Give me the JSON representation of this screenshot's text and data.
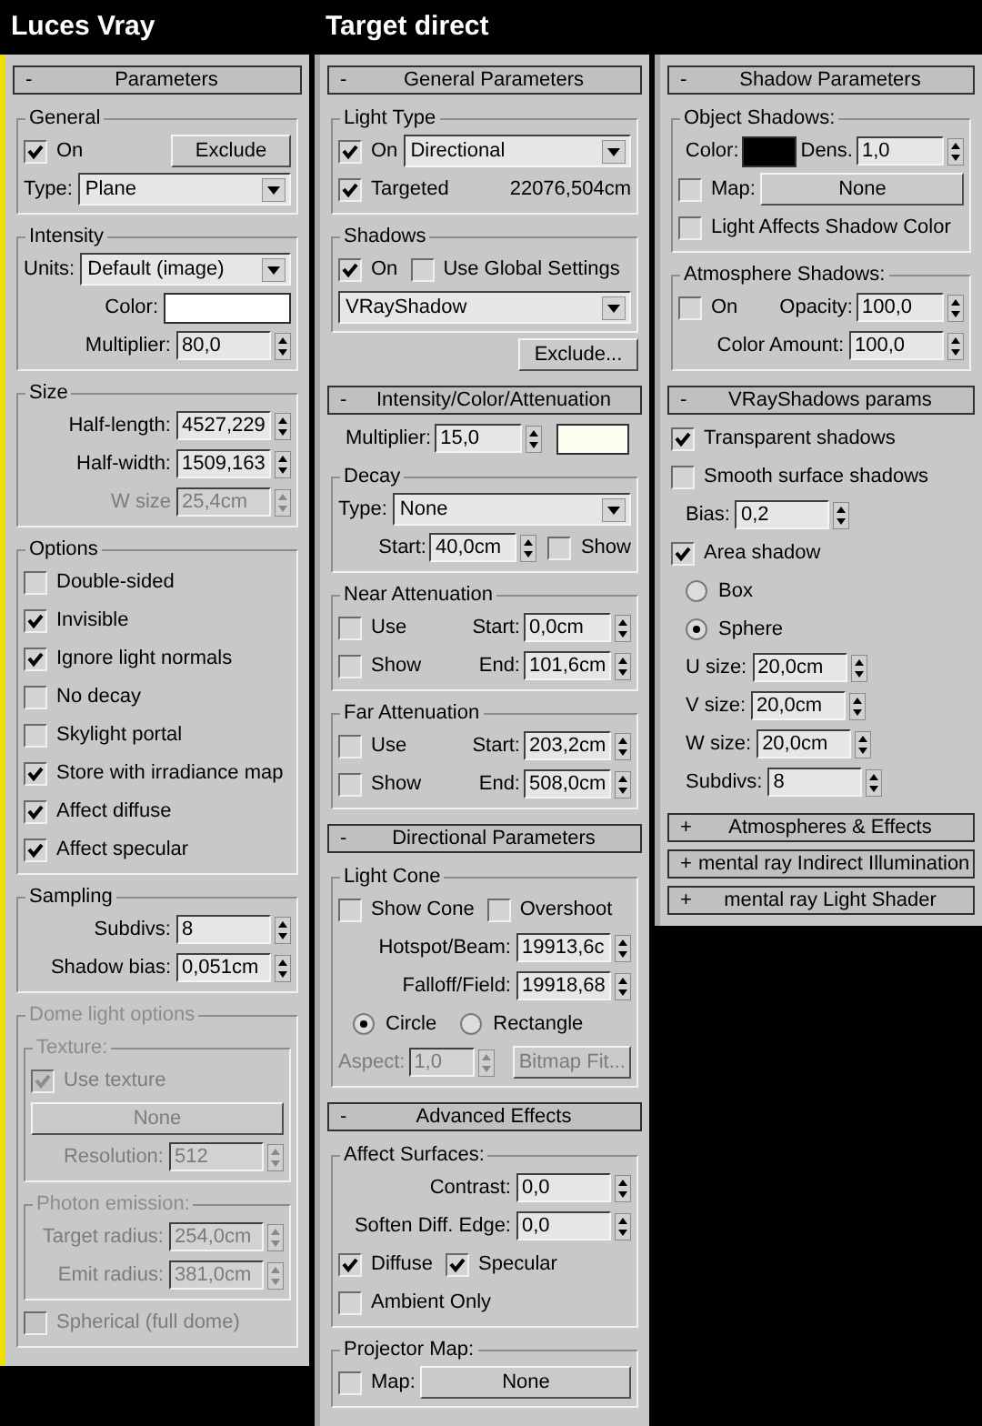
{
  "columns": [
    {
      "title": "Luces Vray",
      "rollouts": [
        {
          "title": "Parameters",
          "sign": "-",
          "content": [
            {
              "kind": "group",
              "title": "General",
              "disabled": false,
              "rows": [
                {
                  "kind": "row",
                  "disabled": false,
                  "items": [
                    {
                      "kind": "check",
                      "label": "On",
                      "checked": true
                    },
                    {
                      "kind": "button",
                      "label": "Exclude"
                    }
                  ]
                },
                {
                  "kind": "row",
                  "disabled": false,
                  "items": [
                    {
                      "kind": "label",
                      "text": "Type:"
                    },
                    {
                      "kind": "dropdown",
                      "value": "Plane"
                    }
                  ]
                }
              ]
            },
            {
              "kind": "group",
              "title": "Intensity",
              "disabled": false,
              "rows": [
                {
                  "kind": "row",
                  "disabled": false,
                  "items": [
                    {
                      "kind": "label",
                      "text": "Units:"
                    },
                    {
                      "kind": "dropdown",
                      "value": "Default (image)"
                    }
                  ]
                },
                {
                  "kind": "row",
                  "disabled": false,
                  "items": [
                    {
                      "kind": "label",
                      "text": "Color:"
                    },
                    {
                      "kind": "swatch",
                      "color": "#ffffff"
                    }
                  ]
                },
                {
                  "kind": "row",
                  "disabled": false,
                  "items": [
                    {
                      "kind": "label",
                      "text": "Multiplier:"
                    },
                    {
                      "kind": "spinner",
                      "value": "80,0"
                    }
                  ]
                }
              ]
            },
            {
              "kind": "group",
              "title": "Size",
              "disabled": false,
              "rows": [
                {
                  "kind": "row",
                  "disabled": false,
                  "items": [
                    {
                      "kind": "label",
                      "text": "Half-length:"
                    },
                    {
                      "kind": "spinner",
                      "value": "4527,229"
                    }
                  ]
                },
                {
                  "kind": "row",
                  "disabled": false,
                  "items": [
                    {
                      "kind": "label",
                      "text": "Half-width:"
                    },
                    {
                      "kind": "spinner",
                      "value": "1509,163"
                    }
                  ]
                },
                {
                  "kind": "row",
                  "disabled": true,
                  "items": [
                    {
                      "kind": "label",
                      "text": "W size"
                    },
                    {
                      "kind": "spinner",
                      "value": "25,4cm"
                    }
                  ]
                }
              ]
            },
            {
              "kind": "group",
              "title": "Options",
              "disabled": false,
              "rows": [
                {
                  "kind": "row",
                  "disabled": false,
                  "items": [
                    {
                      "kind": "check",
                      "label": "Double-sided",
                      "checked": false
                    }
                  ]
                },
                {
                  "kind": "row",
                  "disabled": false,
                  "items": [
                    {
                      "kind": "check",
                      "label": "Invisible",
                      "checked": true
                    }
                  ]
                },
                {
                  "kind": "row",
                  "disabled": false,
                  "items": [
                    {
                      "kind": "check",
                      "label": "Ignore light normals",
                      "checked": true
                    }
                  ]
                },
                {
                  "kind": "row",
                  "disabled": false,
                  "items": [
                    {
                      "kind": "check",
                      "label": "No decay",
                      "checked": false
                    }
                  ]
                },
                {
                  "kind": "row",
                  "disabled": false,
                  "items": [
                    {
                      "kind": "check",
                      "label": "Skylight portal",
                      "checked": false
                    }
                  ]
                },
                {
                  "kind": "row",
                  "disabled": false,
                  "items": [
                    {
                      "kind": "check",
                      "label": "Store with irradiance map",
                      "checked": true
                    }
                  ]
                },
                {
                  "kind": "row",
                  "disabled": false,
                  "items": [
                    {
                      "kind": "check",
                      "label": "Affect diffuse",
                      "checked": true
                    }
                  ]
                },
                {
                  "kind": "row",
                  "disabled": false,
                  "items": [
                    {
                      "kind": "check",
                      "label": "Affect specular",
                      "checked": true
                    }
                  ]
                }
              ]
            },
            {
              "kind": "group",
              "title": "Sampling",
              "disabled": false,
              "rows": [
                {
                  "kind": "row",
                  "disabled": false,
                  "items": [
                    {
                      "kind": "label",
                      "text": "Subdivs:"
                    },
                    {
                      "kind": "spinner",
                      "value": "8"
                    }
                  ]
                },
                {
                  "kind": "row",
                  "disabled": false,
                  "items": [
                    {
                      "kind": "label",
                      "text": "Shadow bias:"
                    },
                    {
                      "kind": "spinner",
                      "value": "0,051cm"
                    }
                  ]
                }
              ]
            },
            {
              "kind": "group",
              "title": "Dome light options",
              "disabled": true,
              "rows": [
                {
                  "kind": "group",
                  "title": "Texture:",
                  "disabled": true,
                  "rows": [
                    {
                      "kind": "row",
                      "disabled": true,
                      "items": [
                        {
                          "kind": "check",
                          "label": "Use texture",
                          "checked": true
                        }
                      ]
                    },
                    {
                      "kind": "row",
                      "disabled": true,
                      "items": [
                        {
                          "kind": "wide-button",
                          "label": "None"
                        }
                      ]
                    },
                    {
                      "kind": "row",
                      "disabled": true,
                      "items": [
                        {
                          "kind": "label",
                          "text": "Resolution:"
                        },
                        {
                          "kind": "spinner",
                          "value": "512"
                        }
                      ]
                    }
                  ]
                },
                {
                  "kind": "group",
                  "title": "Photon emission:",
                  "disabled": true,
                  "rows": [
                    {
                      "kind": "row",
                      "disabled": true,
                      "items": [
                        {
                          "kind": "label",
                          "text": "Target radius:"
                        },
                        {
                          "kind": "spinner",
                          "value": "254,0cm"
                        }
                      ]
                    },
                    {
                      "kind": "row",
                      "disabled": true,
                      "items": [
                        {
                          "kind": "label",
                          "text": "Emit radius:"
                        },
                        {
                          "kind": "spinner",
                          "value": "381,0cm"
                        }
                      ]
                    }
                  ]
                },
                {
                  "kind": "row",
                  "disabled": true,
                  "items": [
                    {
                      "kind": "check",
                      "label": "Spherical (full dome)",
                      "checked": false
                    }
                  ]
                }
              ]
            }
          ]
        }
      ]
    },
    {
      "title": "Target direct",
      "rollouts": [
        {
          "title": "General Parameters",
          "sign": "-",
          "content": [
            {
              "kind": "group",
              "title": "Light Type",
              "disabled": false,
              "rows": [
                {
                  "kind": "row",
                  "disabled": false,
                  "items": [
                    {
                      "kind": "check",
                      "label": "On",
                      "checked": true
                    },
                    {
                      "kind": "dropdown",
                      "value": "Directional"
                    }
                  ]
                },
                {
                  "kind": "row",
                  "disabled": false,
                  "items": [
                    {
                      "kind": "check",
                      "label": "Targeted",
                      "checked": true
                    },
                    {
                      "kind": "text",
                      "text": "22076,504cm"
                    }
                  ]
                }
              ]
            },
            {
              "kind": "group",
              "title": "Shadows",
              "disabled": false,
              "rows": [
                {
                  "kind": "row",
                  "disabled": false,
                  "items": [
                    {
                      "kind": "check",
                      "label": "On",
                      "checked": true
                    },
                    {
                      "kind": "check",
                      "label": "Use Global Settings",
                      "checked": false
                    }
                  ]
                },
                {
                  "kind": "row",
                  "disabled": false,
                  "items": [
                    {
                      "kind": "dropdown",
                      "value": "VRayShadow"
                    }
                  ]
                }
              ]
            },
            {
              "kind": "row",
              "disabled": false,
              "items": [
                {
                  "kind": "button",
                  "label": "Exclude..."
                }
              ]
            }
          ]
        },
        {
          "title": "Intensity/Color/Attenuation",
          "sign": "-",
          "content": [
            {
              "kind": "row",
              "disabled": false,
              "items": [
                {
                  "kind": "label",
                  "text": "Multiplier:"
                },
                {
                  "kind": "spinner",
                  "value": "15,0"
                },
                {
                  "kind": "swatch",
                  "color": "#fdfdf0"
                }
              ]
            },
            {
              "kind": "group",
              "title": "Decay",
              "disabled": false,
              "rows": [
                {
                  "kind": "row",
                  "disabled": false,
                  "items": [
                    {
                      "kind": "label",
                      "text": "Type:"
                    },
                    {
                      "kind": "dropdown",
                      "value": "None"
                    }
                  ]
                },
                {
                  "kind": "row",
                  "disabled": false,
                  "items": [
                    {
                      "kind": "label",
                      "text": "Start:"
                    },
                    {
                      "kind": "spinner",
                      "value": "40,0cm"
                    },
                    {
                      "kind": "check",
                      "label": "Show",
                      "checked": false
                    }
                  ]
                }
              ]
            },
            {
              "kind": "group",
              "title": "Near Attenuation",
              "disabled": false,
              "rows": [
                {
                  "kind": "row",
                  "disabled": false,
                  "items": [
                    {
                      "kind": "check",
                      "label": "Use",
                      "checked": false
                    },
                    {
                      "kind": "label",
                      "text": "Start:"
                    },
                    {
                      "kind": "spinner",
                      "value": "0,0cm"
                    }
                  ]
                },
                {
                  "kind": "row",
                  "disabled": false,
                  "items": [
                    {
                      "kind": "check",
                      "label": "Show",
                      "checked": false
                    },
                    {
                      "kind": "label",
                      "text": "End:"
                    },
                    {
                      "kind": "spinner",
                      "value": "101,6cm"
                    }
                  ]
                }
              ]
            },
            {
              "kind": "group",
              "title": "Far Attenuation",
              "disabled": false,
              "rows": [
                {
                  "kind": "row",
                  "disabled": false,
                  "items": [
                    {
                      "kind": "check",
                      "label": "Use",
                      "checked": false
                    },
                    {
                      "kind": "label",
                      "text": "Start:"
                    },
                    {
                      "kind": "spinner",
                      "value": "203,2cm"
                    }
                  ]
                },
                {
                  "kind": "row",
                  "disabled": false,
                  "items": [
                    {
                      "kind": "check",
                      "label": "Show",
                      "checked": false
                    },
                    {
                      "kind": "label",
                      "text": "End:"
                    },
                    {
                      "kind": "spinner",
                      "value": "508,0cm"
                    }
                  ]
                }
              ]
            }
          ]
        },
        {
          "title": "Directional Parameters",
          "sign": "-",
          "content": [
            {
              "kind": "group",
              "title": "Light Cone",
              "disabled": false,
              "rows": [
                {
                  "kind": "row",
                  "disabled": false,
                  "items": [
                    {
                      "kind": "check",
                      "label": "Show Cone",
                      "checked": false
                    },
                    {
                      "kind": "check",
                      "label": "Overshoot",
                      "checked": false
                    }
                  ]
                },
                {
                  "kind": "row",
                  "disabled": false,
                  "items": [
                    {
                      "kind": "label",
                      "text": "Hotspot/Beam:"
                    },
                    {
                      "kind": "spinner",
                      "value": "19913,6c"
                    }
                  ]
                },
                {
                  "kind": "row",
                  "disabled": false,
                  "items": [
                    {
                      "kind": "label",
                      "text": "Falloff/Field:"
                    },
                    {
                      "kind": "spinner",
                      "value": "19918,68"
                    }
                  ]
                },
                {
                  "kind": "row",
                  "disabled": false,
                  "items": [
                    {
                      "kind": "radio",
                      "label": "Circle",
                      "selected": true
                    },
                    {
                      "kind": "radio",
                      "label": "Rectangle",
                      "selected": false
                    }
                  ]
                },
                {
                  "kind": "row",
                  "disabled": true,
                  "items": [
                    {
                      "kind": "label",
                      "text": "Aspect:"
                    },
                    {
                      "kind": "spinner",
                      "value": "1,0"
                    },
                    {
                      "kind": "button",
                      "label": "Bitmap Fit..."
                    }
                  ]
                }
              ]
            }
          ]
        },
        {
          "title": "Advanced Effects",
          "sign": "-",
          "content": [
            {
              "kind": "group",
              "title": "Affect Surfaces:",
              "disabled": false,
              "rows": [
                {
                  "kind": "row",
                  "disabled": false,
                  "items": [
                    {
                      "kind": "label",
                      "text": "Contrast:"
                    },
                    {
                      "kind": "spinner",
                      "value": "0,0"
                    }
                  ]
                },
                {
                  "kind": "row",
                  "disabled": false,
                  "items": [
                    {
                      "kind": "label",
                      "text": "Soften Diff. Edge:"
                    },
                    {
                      "kind": "spinner",
                      "value": "0,0"
                    }
                  ]
                },
                {
                  "kind": "row",
                  "disabled": false,
                  "items": [
                    {
                      "kind": "check",
                      "label": "Diffuse",
                      "checked": true
                    },
                    {
                      "kind": "check",
                      "label": "Specular",
                      "checked": true
                    }
                  ]
                },
                {
                  "kind": "row",
                  "disabled": false,
                  "items": [
                    {
                      "kind": "check",
                      "label": "Ambient Only",
                      "checked": false
                    }
                  ]
                }
              ]
            },
            {
              "kind": "group",
              "title": "Projector Map:",
              "disabled": false,
              "rows": [
                {
                  "kind": "row",
                  "disabled": false,
                  "items": [
                    {
                      "kind": "check",
                      "label": "Map:",
                      "checked": false
                    },
                    {
                      "kind": "wide-button",
                      "label": "None"
                    }
                  ]
                }
              ]
            }
          ]
        }
      ]
    },
    {
      "rollouts": [
        {
          "title": "Shadow Parameters",
          "sign": "-",
          "content": [
            {
              "kind": "group",
              "title": "Object Shadows:",
              "disabled": false,
              "rows": [
                {
                  "kind": "row",
                  "disabled": false,
                  "items": [
                    {
                      "kind": "label",
                      "text": "Color:"
                    },
                    {
                      "kind": "swatch",
                      "color": "#000000"
                    },
                    {
                      "kind": "label",
                      "text": "Dens."
                    },
                    {
                      "kind": "spinner",
                      "value": "1,0"
                    }
                  ]
                },
                {
                  "kind": "row",
                  "disabled": false,
                  "items": [
                    {
                      "kind": "check",
                      "label": "Map:",
                      "checked": false
                    },
                    {
                      "kind": "wide-button",
                      "label": "None"
                    }
                  ]
                },
                {
                  "kind": "row",
                  "disabled": false,
                  "items": [
                    {
                      "kind": "check",
                      "label": "Light Affects Shadow Color",
                      "checked": false
                    }
                  ]
                }
              ]
            },
            {
              "kind": "group",
              "title": "Atmosphere Shadows:",
              "disabled": false,
              "rows": [
                {
                  "kind": "row",
                  "disabled": false,
                  "items": [
                    {
                      "kind": "check",
                      "label": "On",
                      "checked": false
                    },
                    {
                      "kind": "label",
                      "text": "Opacity:"
                    },
                    {
                      "kind": "spinner",
                      "value": "100,0"
                    }
                  ]
                },
                {
                  "kind": "row",
                  "disabled": false,
                  "items": [
                    {
                      "kind": "label",
                      "text": "Color Amount:"
                    },
                    {
                      "kind": "spinner",
                      "value": "100,0"
                    }
                  ]
                }
              ]
            }
          ]
        },
        {
          "title": "VRayShadows params",
          "sign": "-",
          "content": [
            {
              "kind": "row",
              "disabled": false,
              "items": [
                {
                  "kind": "check",
                  "label": "Transparent shadows",
                  "checked": true
                }
              ]
            },
            {
              "kind": "row",
              "disabled": false,
              "items": [
                {
                  "kind": "check",
                  "label": "Smooth surface shadows",
                  "checked": false
                }
              ]
            },
            {
              "kind": "row",
              "disabled": false,
              "items": [
                {
                  "kind": "label",
                  "text": "Bias:"
                },
                {
                  "kind": "spinner",
                  "value": "0,2"
                }
              ]
            },
            {
              "kind": "row",
              "disabled": false,
              "items": [
                {
                  "kind": "check",
                  "label": "Area shadow",
                  "checked": true
                }
              ]
            },
            {
              "kind": "row",
              "disabled": false,
              "items": [
                {
                  "kind": "radio",
                  "label": "Box",
                  "selected": false
                }
              ]
            },
            {
              "kind": "row",
              "disabled": false,
              "items": [
                {
                  "kind": "radio",
                  "label": "Sphere",
                  "selected": true
                }
              ]
            },
            {
              "kind": "row",
              "disabled": false,
              "items": [
                {
                  "kind": "label",
                  "text": "U size:"
                },
                {
                  "kind": "spinner",
                  "value": "20,0cm"
                }
              ]
            },
            {
              "kind": "row",
              "disabled": false,
              "items": [
                {
                  "kind": "label",
                  "text": "V size:"
                },
                {
                  "kind": "spinner",
                  "value": "20,0cm"
                }
              ]
            },
            {
              "kind": "row",
              "disabled": false,
              "items": [
                {
                  "kind": "label",
                  "text": "W size:"
                },
                {
                  "kind": "spinner",
                  "value": "20,0cm"
                }
              ]
            },
            {
              "kind": "row",
              "disabled": false,
              "items": [
                {
                  "kind": "label",
                  "text": "Subdivs:"
                },
                {
                  "kind": "spinner",
                  "value": "8"
                }
              ]
            }
          ]
        },
        {
          "title": "Atmospheres & Effects",
          "sign": "+"
        },
        {
          "title": "mental ray Indirect Illumination",
          "sign": "+"
        },
        {
          "title": "mental ray Light Shader",
          "sign": "+"
        }
      ]
    }
  ]
}
